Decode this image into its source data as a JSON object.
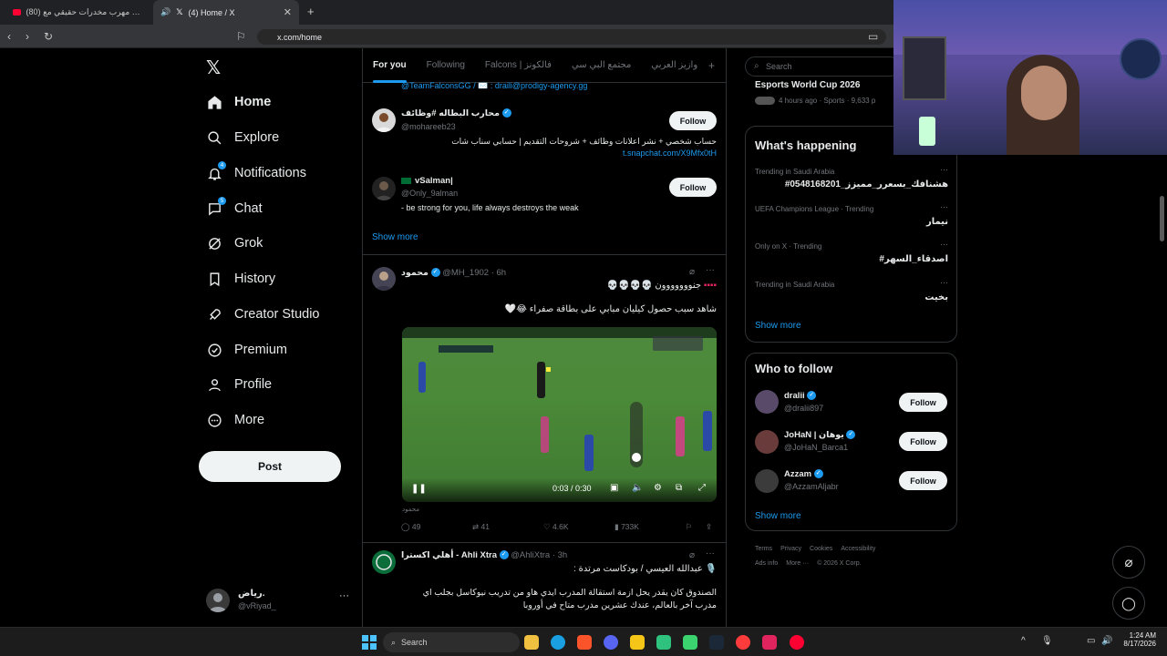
{
  "browser": {
    "tabs": [
      {
        "title": "(80) داهمت مهرب مخدرات حقيقي مع ..."
      },
      {
        "title": "(4) Home / X"
      }
    ],
    "url": "x.com/home"
  },
  "sidebar": {
    "items": [
      {
        "label": "Home"
      },
      {
        "label": "Explore"
      },
      {
        "label": "Notifications",
        "badge": "4"
      },
      {
        "label": "Chat",
        "badge": "5"
      },
      {
        "label": "Grok"
      },
      {
        "label": "History"
      },
      {
        "label": "Creator Studio"
      },
      {
        "label": "Premium"
      },
      {
        "label": "Profile"
      },
      {
        "label": "More"
      }
    ],
    "post_label": "Post",
    "account": {
      "name": "رياض.",
      "handle": "@vRiyad_"
    }
  },
  "feed": {
    "tabs": [
      "For you",
      "Following",
      "Falcons | فالكونز",
      "مجتمع البي سي",
      "وازيز العربي"
    ],
    "partial_line": "@TeamFalconsGG / ✉️ : draili@prodigy-agency.gg",
    "suggestions": [
      {
        "name": "محارب البطاله #وظائف",
        "handle": "@mohareeb23",
        "bio": "حساب شخصي + نشر اعلانات وظائف + شروحات التقديم | حسابي سناب شات",
        "link": "t.snapchat.com/X9Mfx0tH",
        "follow_label": "Follow"
      },
      {
        "name": "vSalman|",
        "handle": "@Only_9alman",
        "bio": "- be strong for you, life always destroys the weak",
        "follow_label": "Follow"
      }
    ],
    "show_more": "Show more",
    "tweet1": {
      "name": "محمود",
      "handle": "@MH_1902",
      "time": "6h",
      "line1": "جنووووووون 💀💀💀💀",
      "line2": "شاهد سبب حصول كيليان مبابي على بطاقة صفراء 😂🤍",
      "video_time": "0:03 / 0:30",
      "source": "محمود",
      "replies": "49",
      "reposts": "41",
      "likes": "4.6K",
      "views": "733K"
    },
    "tweet2": {
      "name": "أهلي اكسترا - Ahli Xtra",
      "handle": "@AhliXtra",
      "time": "3h",
      "line1": "🎙️ عبدالله العيسي / بودكاست مرتدة :",
      "line2": "الصندوق كان يقدر يحل ازمة استقالة المدرب ايدي هاو من تدريب نيوكاسل بجلب اي",
      "line3": "مدرب آخر بالعالم، عندك عشرين مدرب متاح في أوروبا"
    }
  },
  "right": {
    "search_placeholder": "Search",
    "event": {
      "title": "Esports World Cup 2026",
      "meta": "4 hours ago · Sports · 9,633 p"
    },
    "happening_title": "What's happening",
    "trends": [
      {
        "meta": "Trending in Saudi Arabia",
        "topic": "#هشنافك_بسعرر_مميزز_0548168201"
      },
      {
        "meta": "UEFA Champions League · Trending",
        "topic": "نيمار"
      },
      {
        "meta": "Only on X · Trending",
        "topic": "#اصدقاء_السهر"
      },
      {
        "meta": "Trending in Saudi Arabia",
        "topic": "بخيت"
      }
    ],
    "show_more": "Show more",
    "wtf_title": "Who to follow",
    "who_to_follow": [
      {
        "name": "dralii",
        "handle": "@dralii897",
        "follow_label": "Follow"
      },
      {
        "name": "JoHaN | يوهان",
        "handle": "@JoHaN_Barca1",
        "follow_label": "Follow"
      },
      {
        "name": "Azzam",
        "handle": "@AzzamAljabr",
        "follow_label": "Follow"
      }
    ],
    "wtf_show_more": "Show more",
    "footer": {
      "line1": [
        "Terms",
        "Privacy",
        "Cookies",
        "Accessibility"
      ],
      "line2": [
        "Ads info",
        "More ···",
        "© 2026 X Corp."
      ]
    }
  },
  "taskbar": {
    "search_label": "Search",
    "time": "1:24 AM",
    "date": "8/17/2026"
  },
  "colors": {
    "accent": "#1d9bf0",
    "background": "#000000",
    "border": "#2f3336"
  }
}
